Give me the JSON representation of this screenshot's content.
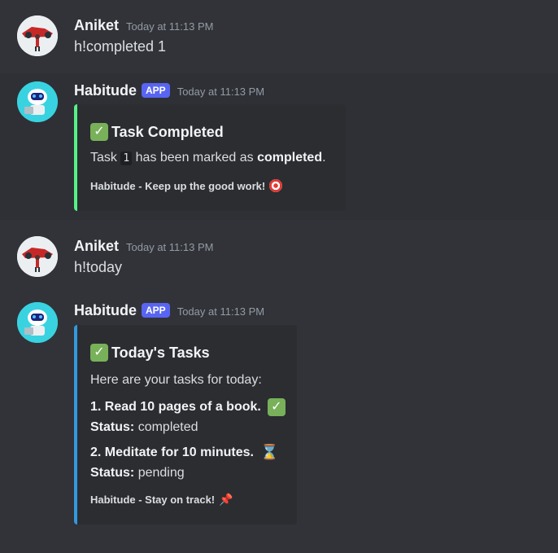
{
  "messages": [
    {
      "author": "Aniket",
      "timestamp": "Today at 11:13 PM",
      "text": "h!completed 1"
    },
    {
      "author": "Habitude",
      "badge": "APP",
      "timestamp": "Today at 11:13 PM",
      "embed": {
        "color": "#57f287",
        "title": "Task Completed",
        "desc_prefix": "Task",
        "desc_code": "1",
        "desc_mid": "has been marked as",
        "desc_bold": "completed",
        "desc_suffix": ".",
        "footer": "Habitude - Keep up the good work!"
      }
    },
    {
      "author": "Aniket",
      "timestamp": "Today at 11:13 PM",
      "text": "h!today"
    },
    {
      "author": "Habitude",
      "badge": "APP",
      "timestamp": "Today at 11:13 PM",
      "embed": {
        "color": "#3498db",
        "title": "Today's Tasks",
        "intro": "Here are your tasks for today:",
        "tasks": [
          {
            "title": "1. Read 10 pages of a book.",
            "status_label": "Status:",
            "status": "completed",
            "icon": "check-icon"
          },
          {
            "title": "2. Meditate for 10 minutes.",
            "status_label": "Status:",
            "status": "pending",
            "icon": "hourglass-icon"
          }
        ],
        "footer": "Habitude - Stay on track!"
      }
    }
  ],
  "colors": {
    "background": "#313338",
    "embed_bg": "#2b2d31",
    "app_badge": "#5865f2",
    "green_bar": "#57f287",
    "blue_bar": "#3498db"
  }
}
